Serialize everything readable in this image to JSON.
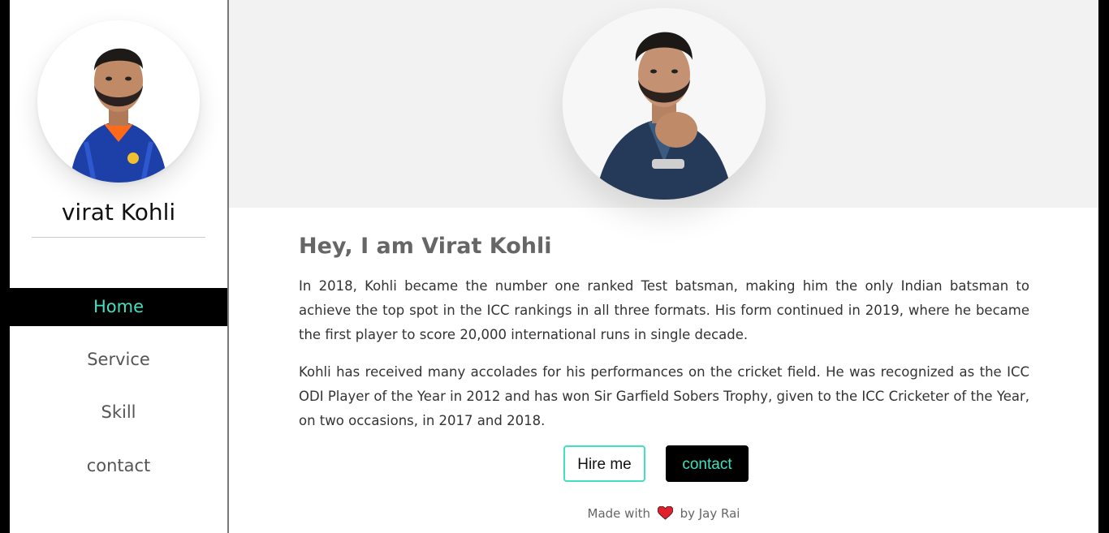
{
  "sidebar": {
    "name": "virat Kohli",
    "nav": [
      {
        "label": "Home",
        "active": true
      },
      {
        "label": "Service",
        "active": false
      },
      {
        "label": "Skill",
        "active": false
      },
      {
        "label": "contact",
        "active": false
      }
    ]
  },
  "main": {
    "heading": "Hey, I am Virat Kohli",
    "paragraphs": [
      "In 2018, Kohli became the number one ranked Test batsman, making him the only Indian batsman to achieve the top spot in the ICC rankings in all three formats. His form continued in 2019, where he became the first player to score 20,000 international runs in single decade.",
      "Kohli has received many accolades for his performances on the cricket field. He was recognized as the ICC ODI Player of the Year in 2012 and has won Sir Garfield Sobers Trophy, given to the ICC Cricketer of the Year, on two occasions, in 2017 and 2018."
    ],
    "buttons": {
      "hire": "Hire me",
      "contact": "contact"
    },
    "footer": {
      "prefix": "Made with",
      "suffix": "by Jay Rai",
      "icon": "heart-icon"
    }
  },
  "colors": {
    "accent": "#40e0c0",
    "nav_active_bg": "#000000",
    "heart": "#e0202a",
    "hero_bg": "#f2f2f2"
  }
}
